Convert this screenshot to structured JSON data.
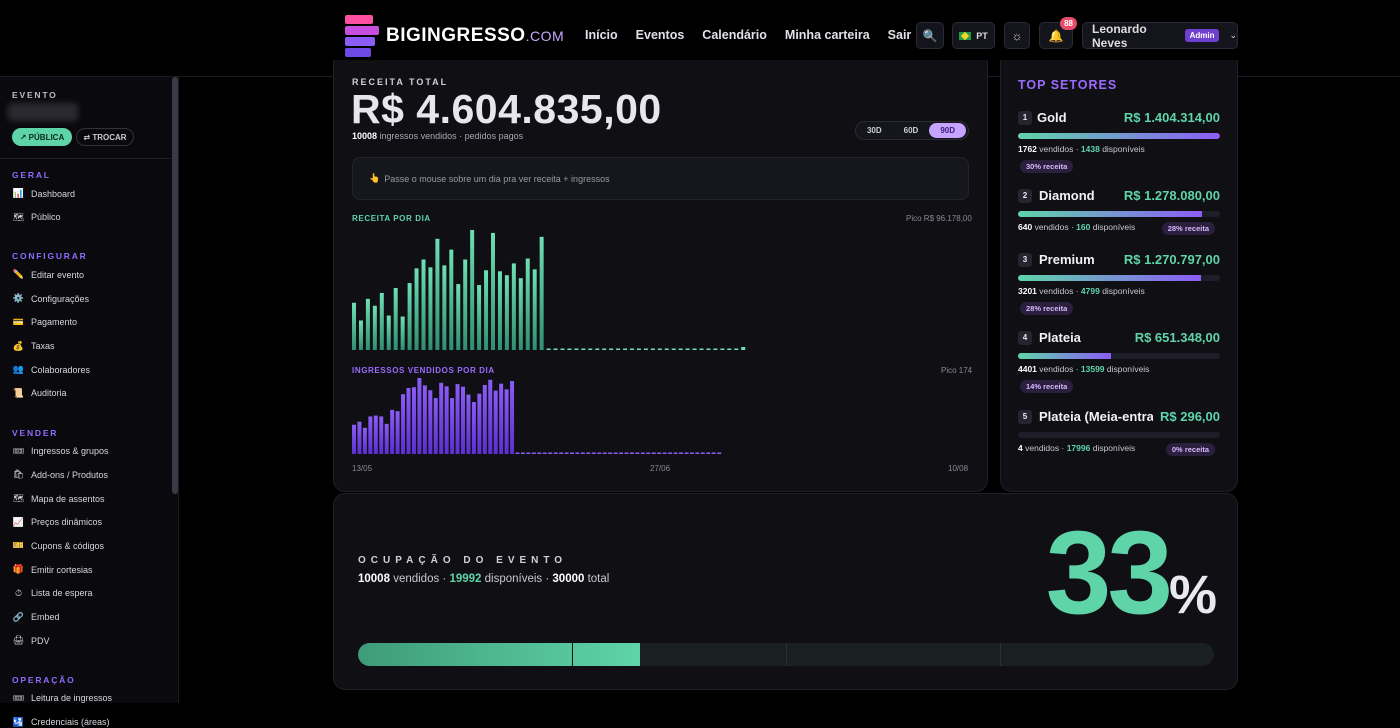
{
  "header": {
    "brand": "BIGINGRESSO",
    "brand_suffix": ".COM",
    "nav": [
      "Início",
      "Eventos",
      "Calendário",
      "Minha carteira",
      "Sair"
    ],
    "lang": "PT",
    "notif_count": "88",
    "user_name": "Leonardo Neves",
    "user_role": "Admin"
  },
  "sidebar": {
    "evento_label": "EVENTO",
    "publica": "↗ PÚBLICA",
    "trocar": "⇄ TROCAR",
    "sections": [
      {
        "title": "GERAL",
        "items": [
          {
            "icon": "📊",
            "label": "Dashboard"
          },
          {
            "icon": "🗺",
            "label": "Público"
          }
        ]
      },
      {
        "title": "CONFIGURAR",
        "items": [
          {
            "icon": "✏️",
            "label": "Editar evento"
          },
          {
            "icon": "⚙️",
            "label": "Configurações"
          },
          {
            "icon": "💳",
            "label": "Pagamento"
          },
          {
            "icon": "💰",
            "label": "Taxas"
          },
          {
            "icon": "👥",
            "label": "Colaboradores"
          },
          {
            "icon": "📜",
            "label": "Auditoria"
          }
        ]
      },
      {
        "title": "VENDER",
        "items": [
          {
            "icon": "🎟",
            "label": "Ingressos & grupos"
          },
          {
            "icon": "🛍",
            "label": "Add-ons / Produtos"
          },
          {
            "icon": "🗺",
            "label": "Mapa de assentos"
          },
          {
            "icon": "📈",
            "label": "Preços dinâmicos"
          },
          {
            "icon": "🎫",
            "label": "Cupons & códigos"
          },
          {
            "icon": "🎁",
            "label": "Emitir cortesias"
          },
          {
            "icon": "⏱",
            "label": "Lista de espera"
          },
          {
            "icon": "🔗",
            "label": "Embed"
          },
          {
            "icon": "🖨",
            "label": "PDV"
          }
        ]
      },
      {
        "title": "OPERAÇÃO",
        "items": [
          {
            "icon": "🎟",
            "label": "Leitura de ingressos"
          },
          {
            "icon": "🛂",
            "label": "Credenciais (áreas)"
          }
        ]
      }
    ]
  },
  "revenue": {
    "label": "RECEITA TOTAL",
    "value": "R$ 4.604.835,00",
    "count": "10008",
    "sub": "ingressos vendidos · pedidos pagos",
    "ranges": [
      "30D",
      "60D",
      "90D"
    ],
    "hint_icon": "👆",
    "hint": "Passe o mouse sobre um dia pra ver receita + ingressos"
  },
  "chart_data": [
    {
      "type": "bar",
      "title": "RECEITA POR DIA",
      "peak_label": "Pico R$ 96.178,00",
      "values": [
        48,
        30,
        52,
        45,
        58,
        35,
        63,
        34,
        68,
        83,
        92,
        84,
        113,
        86,
        102,
        67,
        92,
        122,
        66,
        81,
        119,
        80,
        76,
        88,
        73,
        93,
        82,
        115,
        1,
        1,
        1,
        1,
        1,
        1,
        1,
        1,
        1,
        1,
        1,
        1,
        1,
        1,
        1,
        1,
        1,
        1,
        1,
        1,
        1,
        1,
        1,
        1,
        1,
        1,
        1,
        1,
        3
      ]
    },
    {
      "type": "bar",
      "title": "INGRESSOS VENDIDOS POR DIA",
      "peak_label": "Pico 174",
      "x_ticks": [
        "13/05",
        "27/06",
        "10/08"
      ],
      "values": [
        67,
        74,
        60,
        86,
        88,
        86,
        69,
        101,
        98,
        137,
        151,
        153,
        174,
        157,
        146,
        128,
        163,
        155,
        128,
        160,
        154,
        136,
        119,
        138,
        158,
        170,
        145,
        161,
        148,
        167,
        1,
        1,
        1,
        1,
        1,
        1,
        1,
        1,
        1,
        1,
        1,
        1,
        1,
        1,
        1,
        1,
        1,
        1,
        1,
        1,
        1,
        1,
        1,
        1,
        1,
        1,
        1,
        1,
        1,
        1,
        1,
        1,
        1,
        1,
        1,
        1,
        1,
        3
      ]
    }
  ],
  "top_setores": {
    "title": "TOP SETORES",
    "items": [
      {
        "rank": "1",
        "name": "Gold",
        "value": "R$ 1.404.314,00",
        "sold": "1762",
        "avail": "1438",
        "pct": "30% receita",
        "fill": 1.0
      },
      {
        "rank": "2",
        "name": "Diamond",
        "value": "R$ 1.278.080,00",
        "sold": "640",
        "avail": "160",
        "pct": "28% receita",
        "fill": 0.91
      },
      {
        "rank": "3",
        "name": "Premium",
        "value": "R$ 1.270.797,00",
        "sold": "3201",
        "avail": "4799",
        "pct": "28% receita",
        "fill": 0.905
      },
      {
        "rank": "4",
        "name": "Plateia",
        "value": "R$ 651.348,00",
        "sold": "4401",
        "avail": "13599",
        "pct": "14% receita",
        "fill": 0.46
      },
      {
        "rank": "5",
        "name": "Plateia (Meia-entrada)",
        "value": "R$ 296,00",
        "sold": "4",
        "avail": "17996",
        "pct": "0% receita",
        "fill": 0.0
      }
    ],
    "vendidos": "vendidos",
    "disponiveis": "disponíveis"
  },
  "ocupacao": {
    "label": "OCUPAÇÃO DO EVENTO",
    "sold": "10008",
    "avail": "19992",
    "total": "30000",
    "w_vendidos": "vendidos ·",
    "w_disp": "disponíveis ·",
    "w_total": "total",
    "pct": "33",
    "pct_sign": "%",
    "fill": 0.33
  },
  "colors": {
    "accent": "#5fd4a8",
    "purple": "#8b5cf6"
  }
}
